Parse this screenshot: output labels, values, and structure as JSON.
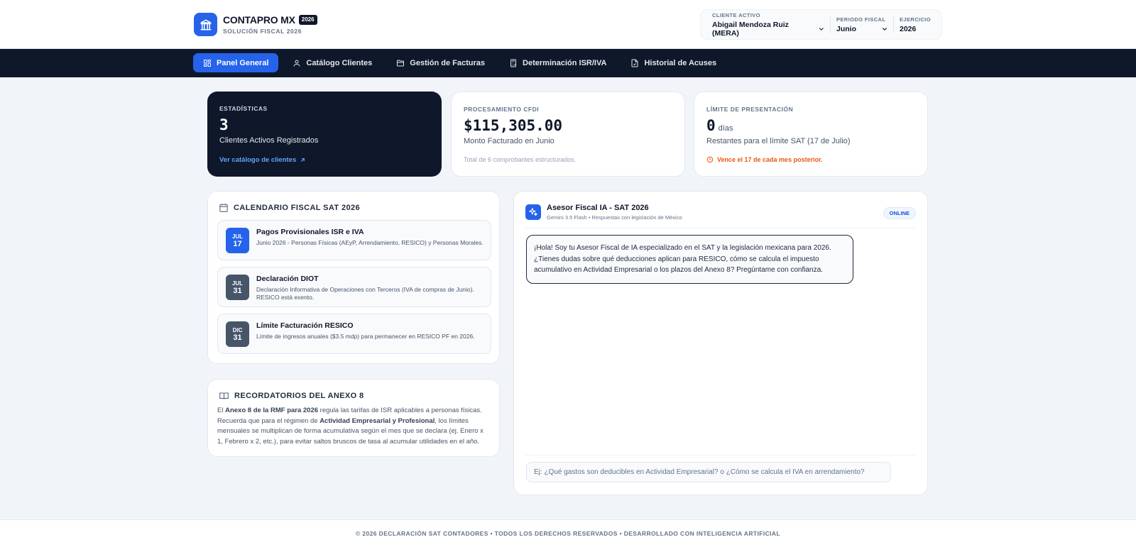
{
  "brand": {
    "name": "CONTAPRO MX",
    "year_badge": "2026",
    "subtitle": "SOLUCIÓN FISCAL 2026",
    "logo_icon": "institution-icon",
    "accent_color": "#2563eb"
  },
  "selectors": {
    "client": {
      "label": "CLIENTE ACTIVO",
      "value": "Abigail Mendoza Ruiz (MERA)"
    },
    "period": {
      "label": "PERIODO FISCAL",
      "value": "Junio"
    },
    "year": {
      "label": "EJERCICIO",
      "value": "2026"
    }
  },
  "nav": {
    "items": [
      {
        "label": "Panel General",
        "icon": "grid-icon",
        "active": true
      },
      {
        "label": "Catálogo Clientes",
        "icon": "user-icon",
        "active": false
      },
      {
        "label": "Gestión de Facturas",
        "icon": "folder-icon",
        "active": false
      },
      {
        "label": "Determinación ISR/IVA",
        "icon": "calculator-icon",
        "active": false
      },
      {
        "label": "Historial de Acuses",
        "icon": "file-check-icon",
        "active": false
      }
    ]
  },
  "stats": {
    "clients": {
      "label": "ESTADÍSTICAS",
      "value": "3",
      "desc": "Clientes Activos Registrados",
      "link": "Ver catálogo de clientes"
    },
    "cfdi": {
      "label": "PROCESAMIENTO CFDI",
      "value": "$115,305.00",
      "desc": "Monto Facturado en Junio",
      "foot": "Total de 6 comprobantes estructurados."
    },
    "deadline": {
      "label": "LÍMITE DE PRESENTACIÓN",
      "value": "0",
      "unit": "días",
      "desc": "Restantes para el límite SAT (17 de Julio)",
      "warning": "Vence el 17 de cada mes posterior.",
      "warning_color": "#ea580c"
    }
  },
  "calendar": {
    "title": "CALENDARIO FISCAL SAT 2026",
    "items": [
      {
        "month": "JUL",
        "day": "17",
        "title": "Pagos Provisionales ISR e IVA",
        "desc": "Junio 2026 - Personas Físicas (AEyP, Arrendamiento, RESICO) y Personas Morales."
      },
      {
        "month": "JUL",
        "day": "31",
        "title": "Declaración DIOT",
        "desc": "Declaración Informativa de Operaciones con Terceros (IVA de compras de Junio). RESICO está exento."
      },
      {
        "month": "DIC",
        "day": "31",
        "title": "Límite Facturación RESICO",
        "desc": "Límite de ingresos anuales ($3.5 mdp) para permanecer en RESICO PF en 2026."
      }
    ]
  },
  "anexo": {
    "title": "RECORDATORIOS DEL ANEXO 8",
    "t1": "El ",
    "b1": "Anexo 8 de la RMF para 2026",
    "t2": " regula las tarifas de ISR aplicables a personas físicas. Recuerda que para el régimen de ",
    "b2": "Actividad Empresarial y Profesional",
    "t3": ", los límites mensuales se multiplican de forma acumulativa según el mes que se declara (ej. Enero x 1, Febrero x 2, etc.), para evitar saltos bruscos de tasa al acumular utilidades en el año."
  },
  "assistant": {
    "title": "Asesor Fiscal IA - SAT 2026",
    "subtitle": "Gemini 3.5 Flash • Respuestas con legislación de México",
    "status": "ONLINE",
    "message": "¡Hola! Soy tu Asesor Fiscal de IA especializado en el SAT y la legislación mexicana para 2026. ¿Tienes dudas sobre qué deducciones aplican para RESICO, cómo se calcula el impuesto acumulativo en Actividad Empresarial o los plazos del Anexo 8? Pregúntame con confianza.",
    "input_placeholder": "Ej: ¿Qué gastos son deducibles en Actividad Empresarial? o ¿Cómo se calcula el IVA en arrendamiento?"
  },
  "footer": {
    "text": "© 2026 DECLARACIÓN SAT CONTADORES • TODOS LOS DERECHOS RESERVADOS • DESARROLLADO CON INTELIGENCIA ARTIFICIAL"
  }
}
